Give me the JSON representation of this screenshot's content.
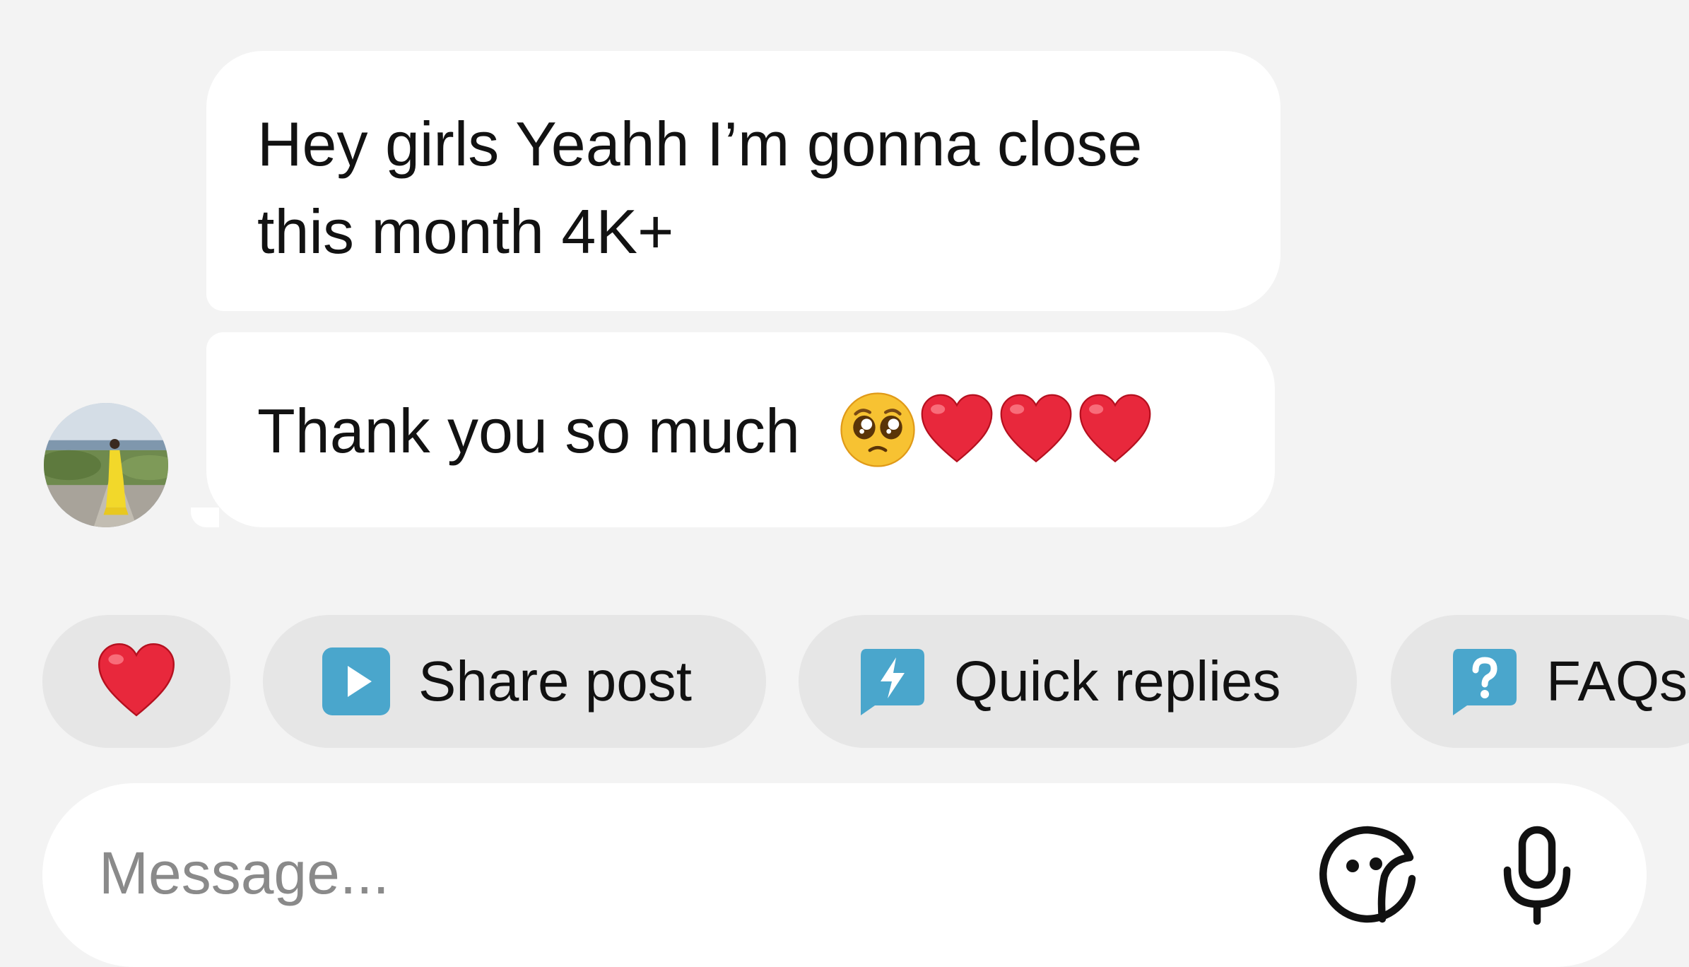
{
  "messages": [
    {
      "text_line1": "Hey girls Yeahh I’m gonna close",
      "text_line2": "this month 4K+"
    },
    {
      "text": "Thank you so much",
      "emojis": [
        "pleading-face",
        "red-heart",
        "red-heart",
        "red-heart"
      ]
    }
  ],
  "quick_actions": {
    "heart_icon": "red-heart-icon",
    "share_post": "Share post",
    "quick_replies": "Quick replies",
    "faqs": "FAQs"
  },
  "composer": {
    "placeholder": "Message..."
  },
  "colors": {
    "background": "#f3f3f3",
    "bubble": "#ffffff",
    "chip": "#e6e6e6",
    "accent_blue": "#4aa6cc",
    "heart_red": "#e8283c"
  }
}
